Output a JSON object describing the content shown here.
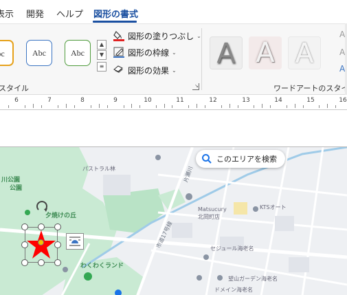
{
  "tabs": [
    {
      "label": "表示",
      "active": false
    },
    {
      "label": "開発",
      "active": false
    },
    {
      "label": "ヘルプ",
      "active": false
    },
    {
      "label": "図形の書式",
      "active": true
    }
  ],
  "ribbon": {
    "shape_styles": {
      "group_label": "スタイル",
      "previews": [
        {
          "label": "bc",
          "border": "#e6a11a"
        },
        {
          "label": "Abc",
          "border": "#3b74c2"
        },
        {
          "label": "Abc",
          "border": "#4d9a3a"
        }
      ]
    },
    "commands": {
      "fill": "図形の塗りつぶし",
      "outline": "図形の枠線",
      "effects": "図形の効果"
    },
    "wordart": {
      "group_label": "ワードアートのスタイル",
      "previews": [
        "A",
        "A",
        "A"
      ]
    }
  },
  "ruler": {
    "labels": [
      "6",
      "7",
      "8",
      "9",
      "10",
      "11",
      "12",
      "13",
      "14",
      "15",
      "16"
    ]
  },
  "map": {
    "search_button": "このエリアを検索",
    "places": [
      {
        "label": "川公園",
        "style": "green"
      },
      {
        "label": "公園",
        "style": "green"
      },
      {
        "label": "パストラル林",
        "style": "normal"
      },
      {
        "label": "夕焼けの丘",
        "style": "green"
      },
      {
        "label": "Matsucury",
        "style": "normal"
      },
      {
        "label": "北岡町店",
        "style": "normal"
      },
      {
        "label": "KTSオート",
        "style": "normal"
      },
      {
        "label": "わくわくランド",
        "style": "green"
      },
      {
        "label": "セジュール海老名",
        "style": "normal"
      },
      {
        "label": "望山ガーデン海老名",
        "style": "normal"
      },
      {
        "label": "ドメイン海老名",
        "style": "normal"
      }
    ],
    "roads": [
      "市道17号線",
      "片瀬川"
    ]
  },
  "shape": {
    "type": "star",
    "fill": "#ff0000"
  },
  "colors": {
    "accent": "#1a4fa0",
    "park": "#b9e3c6",
    "water": "#9fcbe8"
  }
}
